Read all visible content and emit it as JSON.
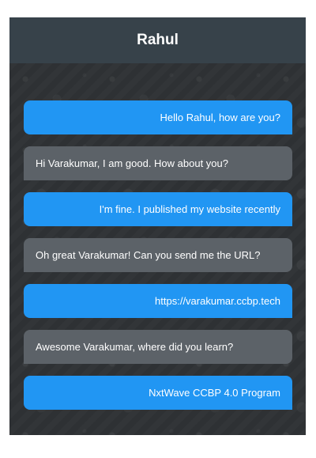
{
  "header": {
    "title": "Rahul"
  },
  "colors": {
    "header_bg": "#37424a",
    "sent_bubble": "#2196f3",
    "received_bubble": "#5c6268",
    "chat_bg": "#2e3134"
  },
  "messages": [
    {
      "direction": "sent",
      "text": "Hello Rahul, how are you?"
    },
    {
      "direction": "received",
      "text": "Hi Varakumar, I am good. How about you?"
    },
    {
      "direction": "sent",
      "text": "I'm fine. I published my website recently"
    },
    {
      "direction": "received",
      "text": "Oh great Varakumar! Can you send me the URL?"
    },
    {
      "direction": "sent",
      "text": "https://varakumar.ccbp.tech"
    },
    {
      "direction": "received",
      "text": "Awesome Varakumar, where did you learn?"
    },
    {
      "direction": "sent",
      "text": "NxtWave CCBP 4.0 Program"
    }
  ]
}
